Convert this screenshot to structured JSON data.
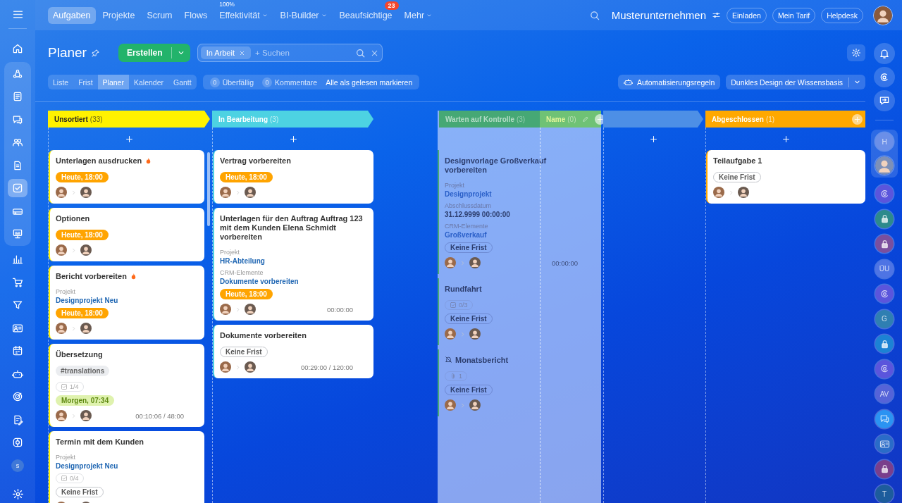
{
  "topbar": {
    "tabs": [
      {
        "label": "Aufgaben",
        "selected": true,
        "dropdown": false
      },
      {
        "label": "Projekte",
        "selected": false,
        "dropdown": false
      },
      {
        "label": "Scrum",
        "selected": false,
        "dropdown": false
      },
      {
        "label": "Flows",
        "selected": false,
        "dropdown": false
      },
      {
        "label": "Effektivität",
        "selected": false,
        "dropdown": true,
        "note": "100%"
      },
      {
        "label": "BI-Builder",
        "selected": false,
        "dropdown": true
      },
      {
        "label": "Beaufsichtige",
        "selected": false,
        "dropdown": false,
        "badge": "23"
      },
      {
        "label": "Mehr",
        "selected": false,
        "dropdown": true
      }
    ],
    "company": "Musterunternehmen",
    "buttons": [
      "Einladen",
      "Mein Tarif",
      "Helpdesk"
    ]
  },
  "page": {
    "title": "Planer",
    "create_button": "Erstellen",
    "search": {
      "chip": "In Arbeit",
      "placeholder": "+ Suchen"
    },
    "views": [
      {
        "label": "Liste",
        "selected": false
      },
      {
        "label": "Frist",
        "selected": false
      },
      {
        "label": "Planer",
        "selected": true
      },
      {
        "label": "Kalender",
        "selected": false
      },
      {
        "label": "Gantt",
        "selected": false
      }
    ],
    "counters": [
      {
        "count": "0",
        "label": "Überfällig"
      },
      {
        "count": "0",
        "label": "Kommentare"
      }
    ],
    "mark_read": "Alle als gelesen markieren",
    "automation_button": "Automatisierungsregeln",
    "design_select": "Dunkles Design der Wissensbasis"
  },
  "sidebar": {
    "top": [
      {
        "kind": "home",
        "selected": false
      }
    ],
    "pinned": [
      {
        "kind": "feed",
        "selected": false
      },
      {
        "kind": "docs",
        "selected": false
      },
      {
        "kind": "chat",
        "selected": false
      },
      {
        "kind": "group",
        "selected": false
      },
      {
        "kind": "file",
        "selected": false
      },
      {
        "kind": "tasks",
        "selected": true
      },
      {
        "kind": "drive",
        "selected": false
      },
      {
        "kind": "board",
        "selected": false
      }
    ],
    "more": [
      {
        "kind": "chart",
        "selected": false
      },
      {
        "kind": "cart",
        "selected": false
      },
      {
        "kind": "filter",
        "selected": false
      },
      {
        "kind": "contacts",
        "selected": false
      },
      {
        "kind": "calendar",
        "selected": false
      },
      {
        "kind": "robot",
        "selected": false
      },
      {
        "kind": "target",
        "selected": false
      },
      {
        "kind": "sign",
        "selected": false
      },
      {
        "kind": "support",
        "selected": false
      }
    ],
    "user_initial": "s"
  },
  "rightbar": {
    "top": [
      {
        "kind": "bell"
      },
      {
        "kind": "spiral"
      },
      {
        "kind": "exitchat"
      }
    ],
    "pinned": [
      {
        "kind": "letter",
        "text": "H",
        "color": "#6b8fe8"
      },
      {
        "kind": "person",
        "color": "#7d90b8"
      }
    ],
    "items": [
      {
        "kind": "spiral",
        "color": "#5b55dc"
      },
      {
        "kind": "lock",
        "color": "#2d8a8c"
      },
      {
        "kind": "lock",
        "color": "#7a4f9e"
      },
      {
        "kind": "letter",
        "text": "ÜU",
        "color": "#4e74e4"
      },
      {
        "kind": "spiral",
        "color": "#5b55dc"
      },
      {
        "kind": "letter",
        "text": "G",
        "color": "#2f7fb2"
      },
      {
        "kind": "lock",
        "color": "#1c82d4"
      },
      {
        "kind": "spiral",
        "color": "#5b55dc"
      },
      {
        "kind": "letter",
        "text": "AV",
        "color": "#5563d8"
      },
      {
        "kind": "chat",
        "color": "#2b93f2"
      },
      {
        "kind": "contacts",
        "color": "#2a6cc8"
      },
      {
        "kind": "lock",
        "color": "#7a3f8c"
      },
      {
        "kind": "letter",
        "text": "T",
        "color": "#1d5c9c"
      }
    ]
  },
  "board": {
    "columns": [
      {
        "kind": "stage",
        "title": "Unsortiert",
        "count": "(33)",
        "color": "#fff200",
        "add_button": true,
        "header_add": false,
        "cards": [
          {
            "title": "Unterlagen ausdrucken",
            "hot": true,
            "muted": false,
            "deadline": {
              "text": "Heute, 18:00",
              "kind": "today"
            }
          },
          {
            "title": "Optionen",
            "hot": false,
            "muted": false,
            "deadline": {
              "text": "Heute, 18:00",
              "kind": "today"
            }
          },
          {
            "title": "Bericht vorbereiten",
            "hot": true,
            "muted": false,
            "fields": [
              {
                "label": "Projekt",
                "value": "Designprojekt Neu",
                "kind": "link"
              }
            ],
            "deadline": {
              "text": "Heute, 18:00",
              "kind": "today"
            }
          },
          {
            "title": "Übersetzung",
            "hot": false,
            "muted": false,
            "tags": [
              "#translations"
            ],
            "checklist": "1/4",
            "deadline": {
              "text": "Morgen, 07:34",
              "kind": "tomorrow"
            },
            "timer": "00:10:06 / 48:00"
          },
          {
            "title": "Termin mit dem Kunden",
            "hot": false,
            "muted": false,
            "fields": [
              {
                "label": "Projekt",
                "value": "Designprojekt Neu",
                "kind": "link"
              }
            ],
            "checklist": "0/4",
            "deadline": {
              "text": "Keine Frist",
              "kind": "none"
            }
          }
        ]
      },
      {
        "kind": "stage",
        "title": "In Bearbeitung",
        "count": "(3)",
        "color": "#4dd2e2",
        "add_button": true,
        "header_add": false,
        "cards": [
          {
            "title": "Vertrag vorbereiten",
            "hot": false,
            "muted": false,
            "deadline": {
              "text": "Heute, 18:00",
              "kind": "today"
            }
          },
          {
            "title": "Unterlagen für den Auftrag Auftrag 123 mit dem Kunden Elena Schmidt vorbereiten",
            "hot": false,
            "muted": false,
            "fields": [
              {
                "label": "Projekt",
                "value": "HR-Abteilung",
                "kind": "link"
              },
              {
                "label": "CRM-Elemente",
                "value": "Dokumente vorbereiten",
                "kind": "link"
              }
            ],
            "deadline": {
              "text": "Heute, 18:00",
              "kind": "today"
            },
            "timer": "00:00:00"
          },
          {
            "title": "Dokumente vorbereiten",
            "hot": false,
            "muted": false,
            "deadline": {
              "text": "Keine Frist",
              "kind": "none"
            },
            "timer": "00:29:00 / 120:00"
          }
        ]
      },
      {
        "kind": "overlay",
        "title": "Warten auf Kontrolle",
        "count": "(3)",
        "color": "#46a875",
        "add_button": false,
        "header_add": false,
        "sub_stage": {
          "title": "Name",
          "count": "(0)",
          "color": "#6fc275"
        },
        "cards": [
          {
            "title": "Designvorlage Großverkauf vorbereiten",
            "hot": false,
            "muted": false,
            "fields": [
              {
                "label": "Projekt",
                "value": "Designprojekt",
                "kind": "link"
              },
              {
                "label": "Abschlussdatum",
                "value": "31.12.9999 00:00:00",
                "kind": "text"
              },
              {
                "label": "CRM-Elemente",
                "value": "Großverkauf",
                "kind": "link"
              }
            ],
            "deadline": {
              "text": "Keine Frist",
              "kind": "none"
            },
            "timer": "00:00:00"
          },
          {
            "title": "Rundfahrt",
            "hot": false,
            "muted": false,
            "checklist": "0/3",
            "deadline": {
              "text": "Keine Frist",
              "kind": "none"
            }
          },
          {
            "title": "Monatsbericht",
            "hot": false,
            "muted": true,
            "attachments": "1",
            "deadline": {
              "text": "Keine Frist",
              "kind": "none"
            }
          }
        ]
      },
      {
        "kind": "stage",
        "color": "#4d8fe6",
        "add_button": true,
        "header_add": false
      },
      {
        "kind": "stage",
        "title": "Abgeschlossen",
        "count": "(1)",
        "color": "#ffa800",
        "add_button": true,
        "header_add": true,
        "cards": [
          {
            "title": "Teilaufgabe 1",
            "hot": false,
            "muted": false,
            "deadline": {
              "text": "Keine Frist",
              "kind": "none"
            }
          }
        ]
      }
    ]
  }
}
